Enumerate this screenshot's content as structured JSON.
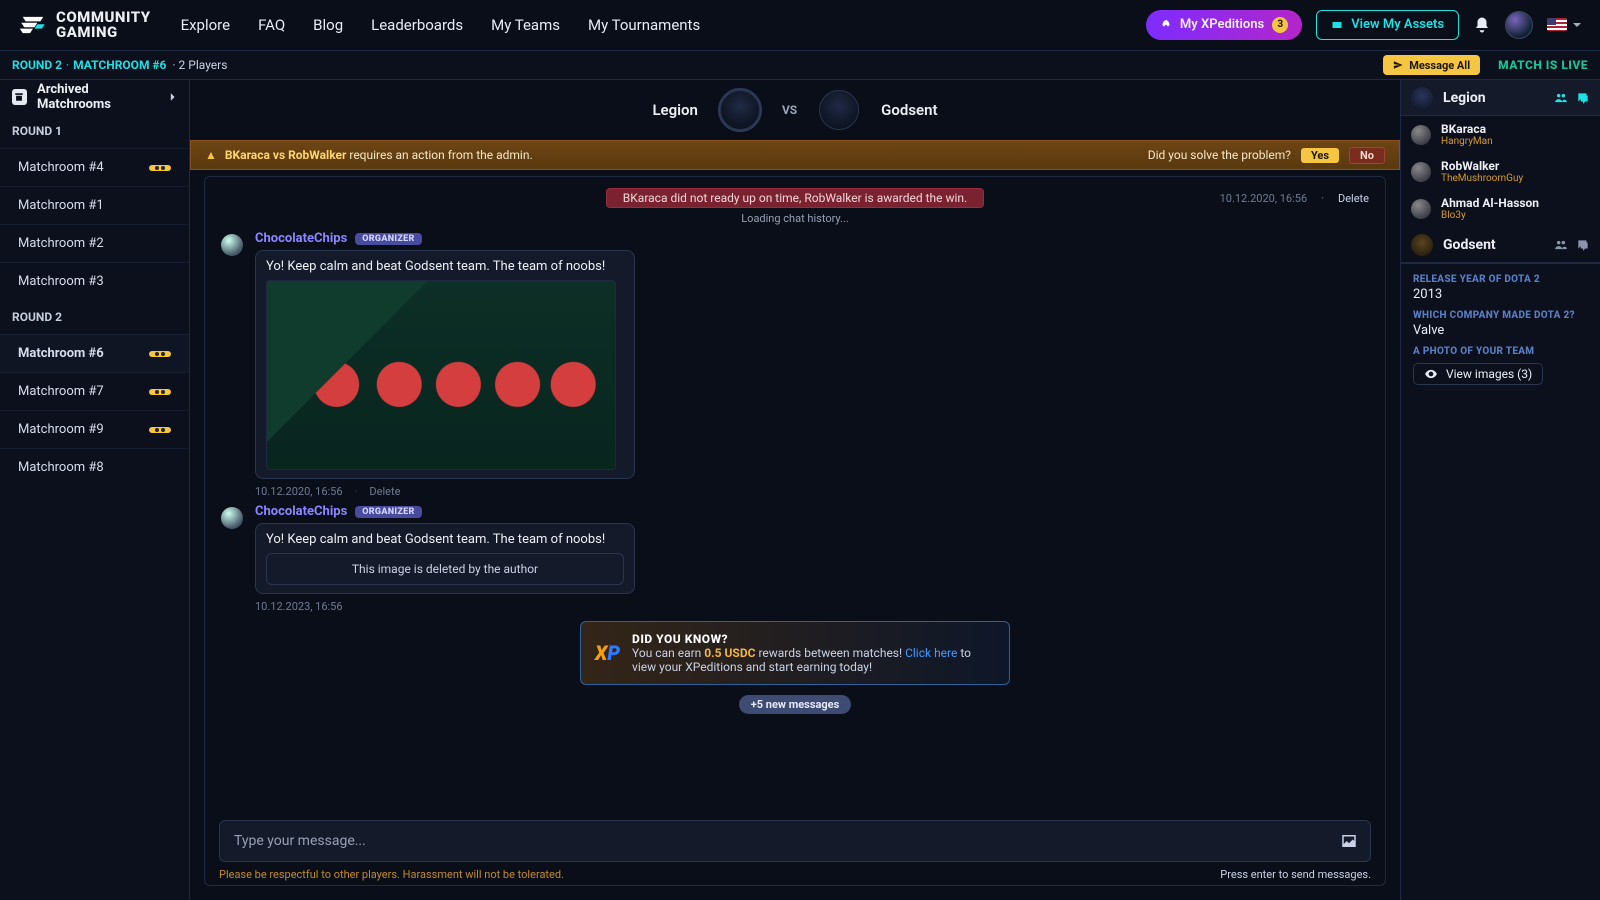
{
  "brand": {
    "line1": "COMMUNITY",
    "line2": "GAMING"
  },
  "nav": {
    "explore": "Explore",
    "faq": "FAQ",
    "blog": "Blog",
    "leaderboards": "Leaderboards",
    "myteams": "My Teams",
    "mytournaments": "My Tournaments"
  },
  "actions": {
    "xped": "My XPeditions",
    "xped_badge": "3",
    "assets": "View My Assets"
  },
  "subbar": {
    "round": "ROUND 2",
    "matchroom": "MATCHROOM #6",
    "players": "2 Players",
    "messageAll": "Message All",
    "live": "MATCH IS LIVE"
  },
  "sidebar": {
    "archived": "Archived Matchrooms",
    "round1": "ROUND 1",
    "round2": "ROUND 2",
    "r1": [
      {
        "label": "Matchroom #4",
        "badge": true
      },
      {
        "label": "Matchroom #1",
        "badge": false
      },
      {
        "label": "Matchroom #2",
        "badge": false
      },
      {
        "label": "Matchroom #3",
        "badge": false
      }
    ],
    "r2": [
      {
        "label": "Matchroom #6",
        "badge": true,
        "active": true
      },
      {
        "label": "Matchroom #7",
        "badge": true
      },
      {
        "label": "Matchroom #9",
        "badge": true
      },
      {
        "label": "Matchroom #8",
        "badge": false
      }
    ]
  },
  "match": {
    "teamA": "Legion",
    "teamB": "Godsent",
    "vs": "VS"
  },
  "adminbar": {
    "players": "BKaraca vs RobWalker",
    "text": " requires an action from the admin.",
    "prompt": "Did you solve the problem?",
    "yes": "Yes",
    "no": "No"
  },
  "system": {
    "banner": "BKaraca did not ready up on time, RobWalker is awarded the win.",
    "time": "10.12.2020, 16:56",
    "delete": "Delete"
  },
  "loading": "Loading chat history...",
  "msg1": {
    "user": "ChocolateChips",
    "tag": "ORGANIZER",
    "text": "Yo! Keep calm and beat Godsent team. The team of noobs!",
    "time": "10.12.2020, 16:56",
    "delete": "Delete"
  },
  "msg2": {
    "user": "ChocolateChips",
    "tag": "ORGANIZER",
    "text": "Yo! Keep calm and beat Godsent team. The team of noobs!",
    "deleted": "This image is deleted by the author",
    "time": "10.12.2023, 16:56"
  },
  "tip": {
    "title": "DID YOU KNOW?",
    "pre": "You can earn ",
    "amount": "0.5 USDC",
    "mid": " rewards between matches! ",
    "link": "Click here",
    "post": " to view your XPeditions and start earning today!"
  },
  "newmsgs": "+5 new messages",
  "input": {
    "placeholder": "Type your message...",
    "warn": "Please be respectful to other players. Harassment will not be tolerated.",
    "hint": "Press enter to send messages."
  },
  "right": {
    "teamA": "Legion",
    "teamB": "Godsent",
    "players": [
      {
        "name": "BKaraca",
        "sub": "HangryMan"
      },
      {
        "name": "RobWalker",
        "sub": "TheMushroomGuy"
      },
      {
        "name": "Ahmad Al-Hasson",
        "sub": "Blo3y"
      }
    ],
    "q1l": "RELEASE YEAR OF DOTA 2",
    "q1v": "2013",
    "q2l": "WHICH COMPANY MADE DOTA 2?",
    "q2v": "Valve",
    "q3l": "A PHOTO OF YOUR TEAM",
    "viewimg": "View images (3)"
  }
}
